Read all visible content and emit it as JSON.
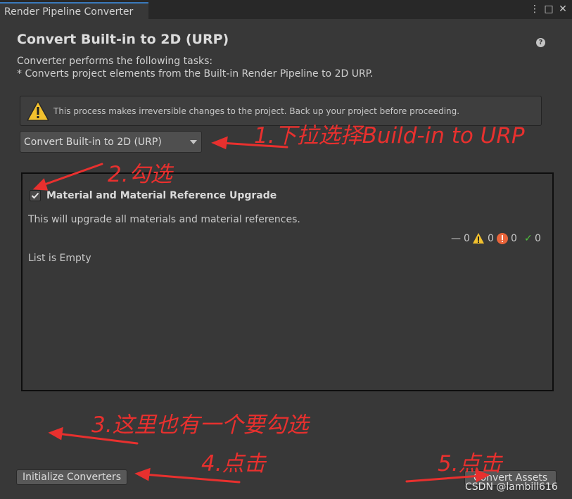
{
  "window": {
    "tab_label": "Render Pipeline Converter",
    "menu_glyph": "⋮",
    "maximize_glyph": "□",
    "close_glyph": "✕"
  },
  "header": {
    "title": "Convert Built-in to 2D (URP)",
    "help_glyph": "?",
    "description_line1": "Converter performs the following tasks:",
    "description_line2": "* Converts project elements from the Built-in Render Pipeline to 2D URP."
  },
  "warning": {
    "icon": "warning-icon",
    "text": "This process makes irreversible changes to the project. Back up your project before proceeding."
  },
  "pipeline_dropdown": {
    "selected": "Convert Built-in to 2D (URP)"
  },
  "converter": {
    "checked": true,
    "title": "Material and Material Reference Upgrade",
    "description": "This will upgrade all materials and material references.",
    "counts": {
      "pending_glyph": "—",
      "pending": "0",
      "warnings": "0",
      "errors": "0",
      "success_glyph": "✓",
      "success": "0"
    },
    "list_status": "List is Empty"
  },
  "buttons": {
    "initialize": "Initialize Converters",
    "convert": "Convert Assets"
  },
  "annotations": {
    "step1": "1.下拉选择Build-in to URP",
    "step2": "2.勾选",
    "step3": "3.这里也有一个要勾选",
    "step4": "4.点击",
    "step5": "5.点击",
    "color": "#e8302e"
  },
  "watermark": "CSDN @lambill616",
  "colors": {
    "background": "#383838",
    "tab_accent": "#3a79bb",
    "warning_yellow": "#f2c12e",
    "error_orange": "#e9643a",
    "success_green": "#4ec33d"
  }
}
